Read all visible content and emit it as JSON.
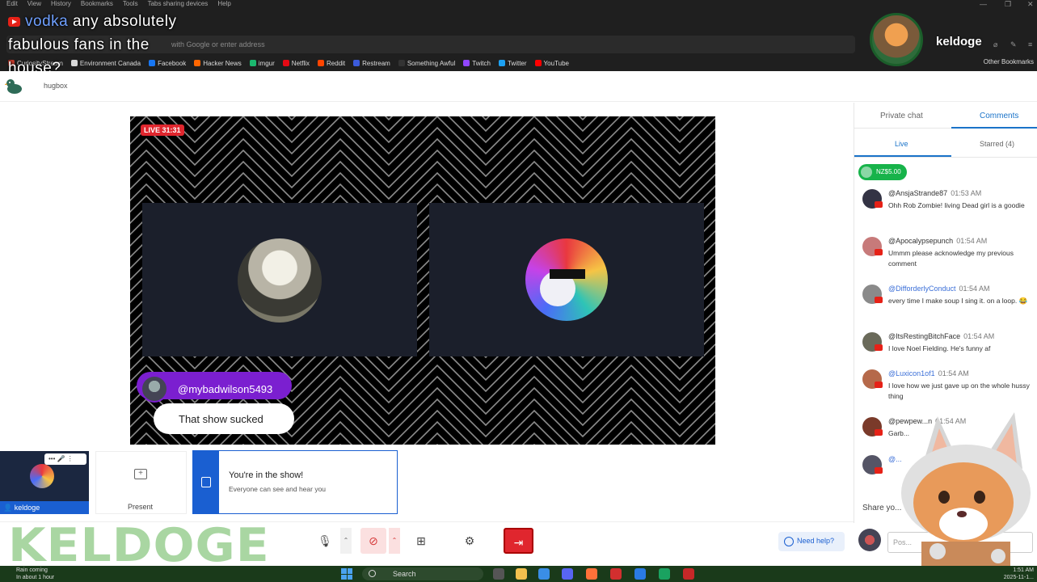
{
  "browser": {
    "menu": [
      "Edit",
      "View",
      "History",
      "Bookmarks",
      "Tools",
      "Tabs sharing devices",
      "Help"
    ],
    "url_placeholder": "with Google or enter address",
    "bookmarks": [
      {
        "label": "CuriosityStream",
        "color": "#c0392b"
      },
      {
        "label": "Environment Canada",
        "color": "#d9d9d9"
      },
      {
        "label": "Facebook",
        "color": "#1877f2"
      },
      {
        "label": "Hacker News",
        "color": "#ff6600"
      },
      {
        "label": "imgur",
        "color": "#1bb76e"
      },
      {
        "label": "Netflix",
        "color": "#e50914"
      },
      {
        "label": "Reddit",
        "color": "#ff4500"
      },
      {
        "label": "Restream",
        "color": "#3b5bdb"
      },
      {
        "label": "Something Awful",
        "color": "#333333"
      },
      {
        "label": "Twitch",
        "color": "#9146ff"
      },
      {
        "label": "Twitter",
        "color": "#1da1f2"
      },
      {
        "label": "YouTube",
        "color": "#ff0000"
      }
    ],
    "other_bookmarks": "Other Bookmarks"
  },
  "caption": {
    "user": "vodka",
    "line1": "any absolutely",
    "line2": "fabulous fans in the",
    "line3": "house?"
  },
  "overlay": {
    "streamer_name": "keldoge",
    "big_logo_text": "KELDOGE"
  },
  "app": {
    "title": "hugbox"
  },
  "stage": {
    "live_badge": "LIVE 31:31",
    "featured_comment": {
      "user": "@mybadwilson5493",
      "text": "That show sucked"
    }
  },
  "right_panel": {
    "tabs": [
      "Private chat",
      "Comments"
    ],
    "active_tab": "Comments",
    "subtabs": [
      "Live",
      "Starred (4)"
    ],
    "donation": "NZ$5.00",
    "comments": [
      {
        "user": "@AnsjaStrande87",
        "time": "01:53 AM",
        "text": "Ohh Rob Zombie! living Dead girl is a goodie",
        "blue": false,
        "avatar_color": "#333344"
      },
      {
        "user": "@Apocalypsepunch",
        "time": "01:54 AM",
        "text": "Ummm please acknowledge my previous comment",
        "blue": false,
        "avatar_color": "#c77a7a"
      },
      {
        "user": "@DifforderlyConduct",
        "time": "01:54 AM",
        "text": "every time I make soup I sing it. on a loop. 😂",
        "blue": true,
        "avatar_color": "#8a8a8a"
      },
      {
        "user": "@ItsRestingBitchFace",
        "time": "01:54 AM",
        "text": "I love Noel Fielding. He's funny af",
        "blue": false,
        "avatar_color": "#6a6a5a"
      },
      {
        "user": "@Luxicon1of1",
        "time": "01:54 AM",
        "text": "I love how we just gave up on the whole hussy thing",
        "blue": true,
        "avatar_color": "#b5694a"
      },
      {
        "user": "@pewpew...n",
        "time": "01:54 AM",
        "text": "Garb...",
        "blue": false,
        "avatar_color": "#7a3a2a"
      },
      {
        "user": "@...",
        "time": "",
        "text": "",
        "blue": true,
        "avatar_color": "#555566"
      }
    ],
    "share_label": "Share yo...",
    "post_placeholder": "Pos..."
  },
  "bottom": {
    "self_name": "keldoge",
    "self_ctrl": "••• 🎤 ⋮",
    "present_label": "Present",
    "show_title": "You're in the show!",
    "show_sub": "Everyone can see and hear you",
    "help_label": "Need help?"
  },
  "taskbar": {
    "weather_line1": "Rain coming",
    "weather_line2": "In about 1 hour",
    "search": "Search",
    "clock_line1": "1:51 AM",
    "clock_line2": "2025-11-1..."
  }
}
